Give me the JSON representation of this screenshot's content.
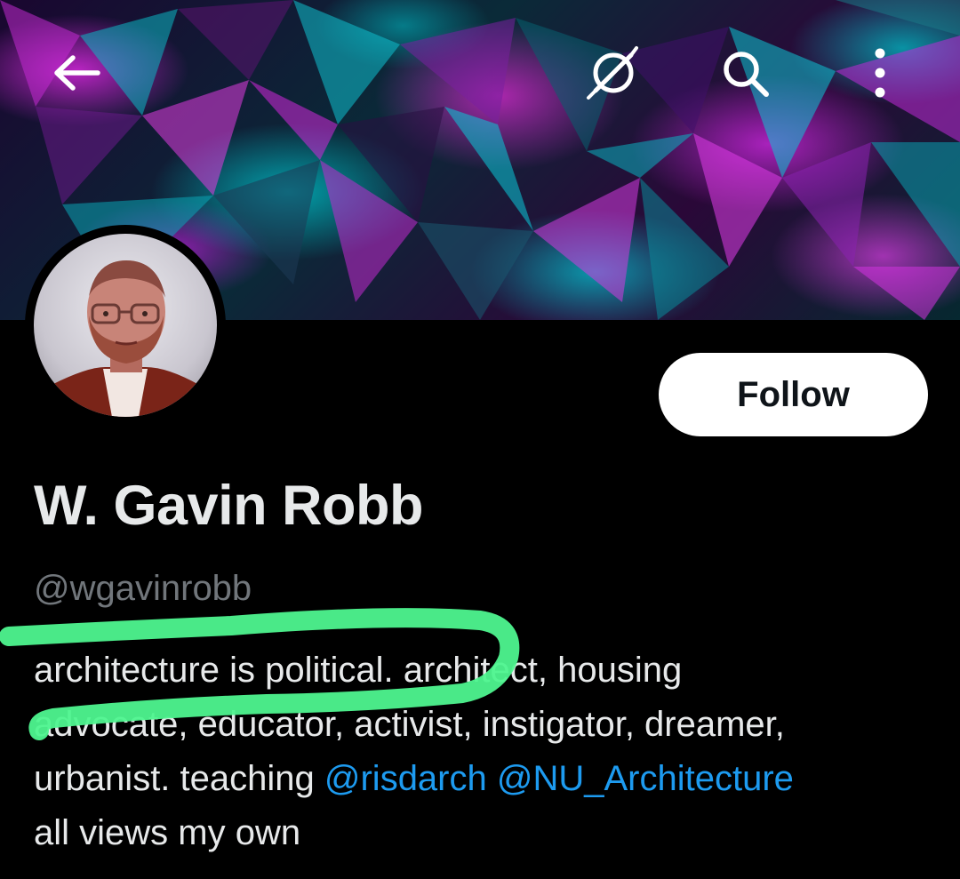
{
  "profile": {
    "display_name": "W. Gavin Robb",
    "handle": "@wgavinrobb",
    "follow_label": "Follow",
    "bio": {
      "line1": "architecture is political.  architect, housing",
      "line2": "advocate, educator, activist, instigator, dreamer,",
      "line3_text": "urbanist. teaching ",
      "mention1": "@risdarch",
      "mention2": "@NU_Architecture",
      "line4": "all views my own"
    }
  },
  "topbar": {
    "icons": [
      "back-arrow-icon",
      "grok-icon",
      "search-icon",
      "more-vertical-icon"
    ]
  },
  "colors": {
    "background": "#000000",
    "text_primary": "#e7e9ea",
    "text_secondary": "#71767b",
    "link": "#1d9bf0",
    "highlighter": "#4ef58f"
  }
}
